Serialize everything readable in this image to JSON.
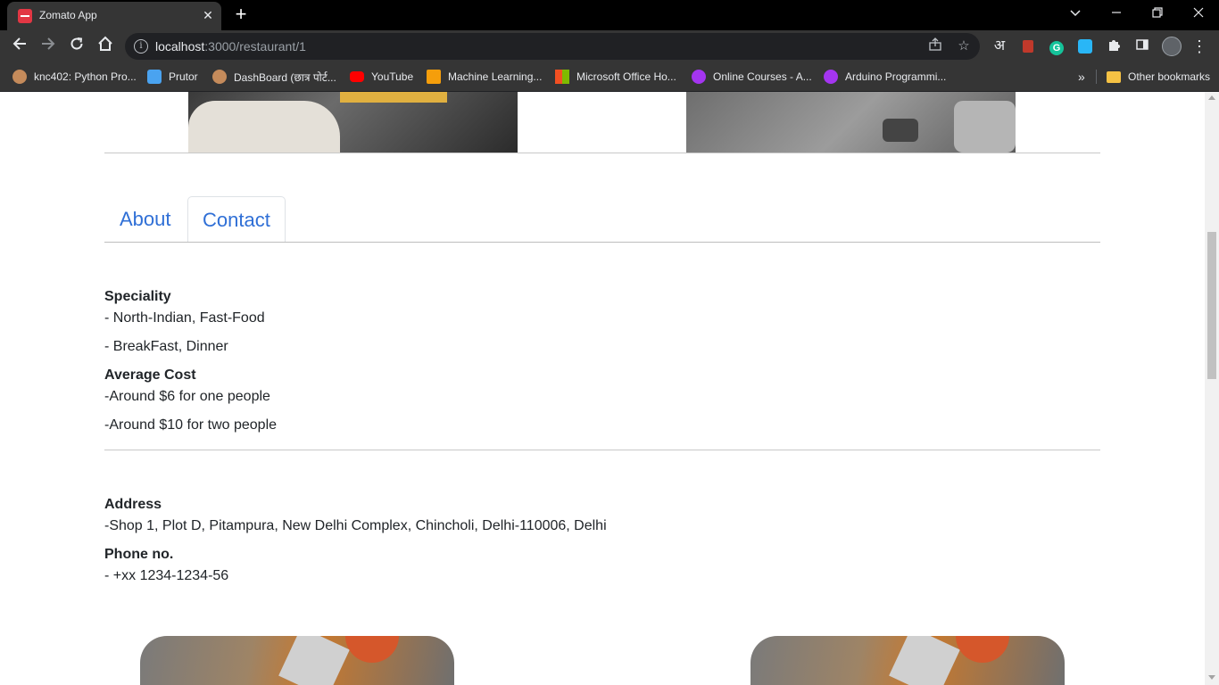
{
  "browser": {
    "tab_title": "Zomato App",
    "tab_close": "✕",
    "new_tab": "+",
    "window_controls": {
      "minimize": "—",
      "maximize": "❐",
      "close": "✕"
    },
    "nav": {
      "back": "←",
      "forward": "→",
      "reload": "↻",
      "home": "⌂"
    },
    "url_host": "localhost",
    "url_path": ":3000/restaurant/1",
    "bookmarks": [
      {
        "label": "knc402: Python Pro...",
        "icon": "globe-icon",
        "color": "#c58b5b"
      },
      {
        "label": "Prutor",
        "icon": "prutor-icon",
        "color": "#4aa3f0"
      },
      {
        "label": "DashBoard (छात्र पोर्ट...",
        "icon": "globe-icon",
        "color": "#c58b5b"
      },
      {
        "label": "YouTube",
        "icon": "youtube-icon",
        "color": "#ff0000"
      },
      {
        "label": "Machine Learning...",
        "icon": "ml-icon",
        "color": "#f59e0b"
      },
      {
        "label": "Microsoft Office Ho...",
        "icon": "microsoft-icon",
        "color": "#f25022"
      },
      {
        "label": "Online Courses - A...",
        "icon": "udemy-icon",
        "color": "#a435f0"
      },
      {
        "label": "Arduino Programmi...",
        "icon": "udemy-icon",
        "color": "#a435f0"
      }
    ],
    "more_bookmarks": "»",
    "other_bookmarks": "Other bookmarks",
    "profile_letter": "अ"
  },
  "page": {
    "tabs": [
      {
        "label": "About",
        "active": false
      },
      {
        "label": "Contact",
        "active": true
      }
    ],
    "speciality": {
      "heading": "Speciality",
      "line1": "- North-Indian, Fast-Food",
      "line2": "- BreakFast, Dinner"
    },
    "average_cost": {
      "heading": "Average Cost",
      "line1": "-Around $6 for one people",
      "line2": "-Around $10 for two people"
    },
    "address": {
      "heading": "Address",
      "value": "-Shop 1, Plot D, Pitampura, New Delhi Complex, Chincholi, Delhi-110006, Delhi"
    },
    "phone": {
      "heading": "Phone no.",
      "value": "- +xx 1234-1234-56"
    }
  },
  "colors": {
    "tab_link": "#2f6fd6",
    "text": "#212529",
    "brand_red": "#e23744"
  }
}
